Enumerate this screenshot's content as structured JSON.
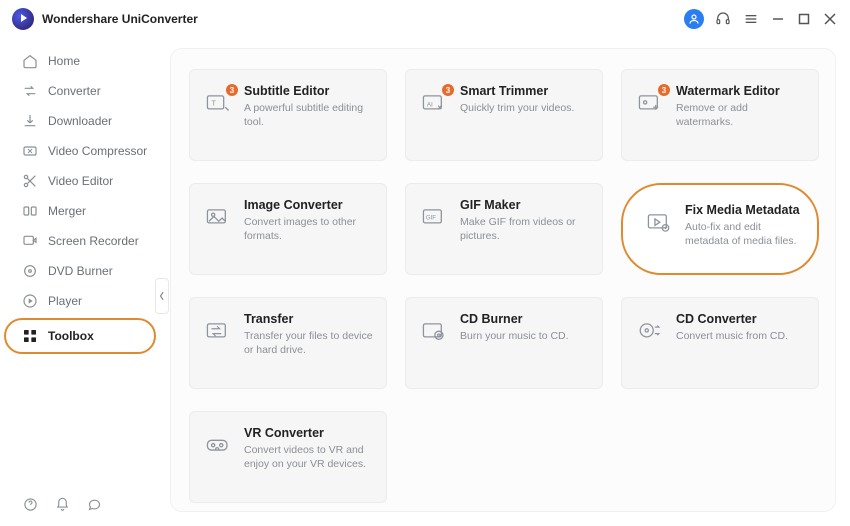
{
  "app": {
    "title": "Wondershare UniConverter"
  },
  "sidebar": {
    "items": [
      {
        "label": "Home"
      },
      {
        "label": "Converter"
      },
      {
        "label": "Downloader"
      },
      {
        "label": "Video Compressor"
      },
      {
        "label": "Video Editor"
      },
      {
        "label": "Merger"
      },
      {
        "label": "Screen Recorder"
      },
      {
        "label": "DVD Burner"
      },
      {
        "label": "Player"
      },
      {
        "label": "Toolbox"
      }
    ]
  },
  "tools": [
    {
      "title": "Subtitle Editor",
      "desc": "A powerful subtitle editing tool.",
      "badge": "3"
    },
    {
      "title": "Smart Trimmer",
      "desc": "Quickly trim your videos.",
      "badge": "3"
    },
    {
      "title": "Watermark Editor",
      "desc": "Remove or add watermarks.",
      "badge": "3"
    },
    {
      "title": "Image Converter",
      "desc": "Convert images to other formats."
    },
    {
      "title": "GIF Maker",
      "desc": "Make GIF from videos or pictures."
    },
    {
      "title": "Fix Media Metadata",
      "desc": "Auto-fix and edit metadata of media files.",
      "highlight": true
    },
    {
      "title": "Transfer",
      "desc": "Transfer your files to device or hard drive."
    },
    {
      "title": "CD Burner",
      "desc": "Burn your music to CD."
    },
    {
      "title": "CD Converter",
      "desc": "Convert music from CD."
    },
    {
      "title": "VR Converter",
      "desc": "Convert videos to VR and enjoy on your VR devices."
    }
  ]
}
